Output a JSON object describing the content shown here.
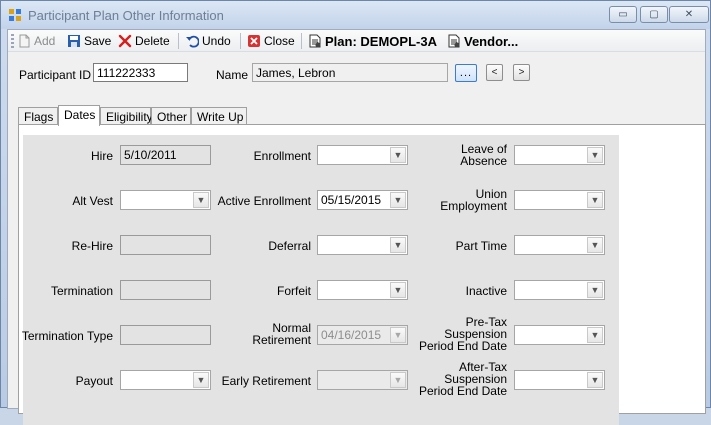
{
  "window": {
    "title": "Participant Plan Other Information",
    "minimize_glyph": "▭",
    "maximize_glyph": "▢",
    "close_glyph": "✕"
  },
  "toolbar": {
    "add_label": "Add",
    "save_label": "Save",
    "delete_label": "Delete",
    "undo_label": "Undo",
    "close_label": "Close",
    "plan_label": "Plan: DEMOPL-3A",
    "vendor_label": "Vendor..."
  },
  "header": {
    "participant_id_label": "Participant ID",
    "participant_id_value": "111222333",
    "name_label": "Name",
    "name_value": "James, Lebron",
    "lookup_label": "...",
    "prev_label": "<",
    "next_label": ">"
  },
  "tabs": [
    {
      "label": "Flags"
    },
    {
      "label": "Dates"
    },
    {
      "label": "Eligibility"
    },
    {
      "label": "Other"
    },
    {
      "label": "Write Up"
    }
  ],
  "active_tab": "Dates",
  "dates": {
    "col1": {
      "hire": {
        "label": "Hire",
        "value": "5/10/2011"
      },
      "alt_vest": {
        "label": "Alt Vest",
        "value": ""
      },
      "rehire": {
        "label": "Re-Hire",
        "value": ""
      },
      "termination": {
        "label": "Termination",
        "value": ""
      },
      "termination_type": {
        "label": "Termination Type",
        "value": ""
      },
      "payout": {
        "label": "Payout",
        "value": ""
      }
    },
    "col2": {
      "enrollment": {
        "label": "Enrollment",
        "value": ""
      },
      "active_enrollment": {
        "label": "Active Enrollment",
        "value": "05/15/2015"
      },
      "deferral": {
        "label": "Deferral",
        "value": ""
      },
      "forfeit": {
        "label": "Forfeit",
        "value": ""
      },
      "normal_retirement": {
        "label_1": "Normal",
        "label_2": "Retirement",
        "value": "04/16/2015"
      },
      "early_retirement": {
        "label": "Early Retirement",
        "value": ""
      }
    },
    "col3": {
      "leave_of_absence": {
        "label_1": "Leave of",
        "label_2": "Absence",
        "value": ""
      },
      "union_employment": {
        "label_1": "Union",
        "label_2": "Employment",
        "value": ""
      },
      "part_time": {
        "label": "Part Time",
        "value": ""
      },
      "inactive": {
        "label": "Inactive",
        "value": ""
      },
      "pretax_suspension": {
        "label_1": "Pre-Tax",
        "label_2": "Suspension",
        "label_3": "Period End Date",
        "value": ""
      },
      "aftertax_suspension": {
        "label_1": "After-Tax",
        "label_2": "Suspension",
        "label_3": "Period End Date",
        "value": ""
      }
    }
  },
  "combo_arrow": "▼"
}
